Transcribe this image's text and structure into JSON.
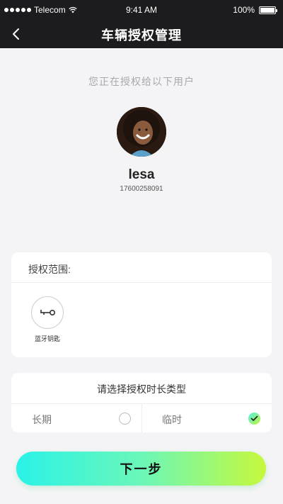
{
  "status_bar": {
    "carrier": "Telecom",
    "time": "9:41 AM",
    "battery": "100%"
  },
  "nav": {
    "title": "车辆授权管理",
    "back_icon": "chevron-left-icon"
  },
  "hint": "您正在授权给以下用户",
  "user": {
    "name": "lesa",
    "phone": "17600258091"
  },
  "scope": {
    "label": "授权范围:",
    "items": [
      {
        "label": "蓝牙钥匙",
        "icon": "bluetooth-key-icon"
      }
    ]
  },
  "duration": {
    "title": "请选择授权时长类型",
    "options": [
      {
        "label": "长期",
        "selected": false
      },
      {
        "label": "临时",
        "selected": true
      }
    ]
  },
  "next_button": "下一步",
  "colors": {
    "header_bg": "#1c1c1e",
    "accent_start": "#2af2e7",
    "accent_end": "#c6f83c",
    "page_bg": "#f4f4f6"
  }
}
